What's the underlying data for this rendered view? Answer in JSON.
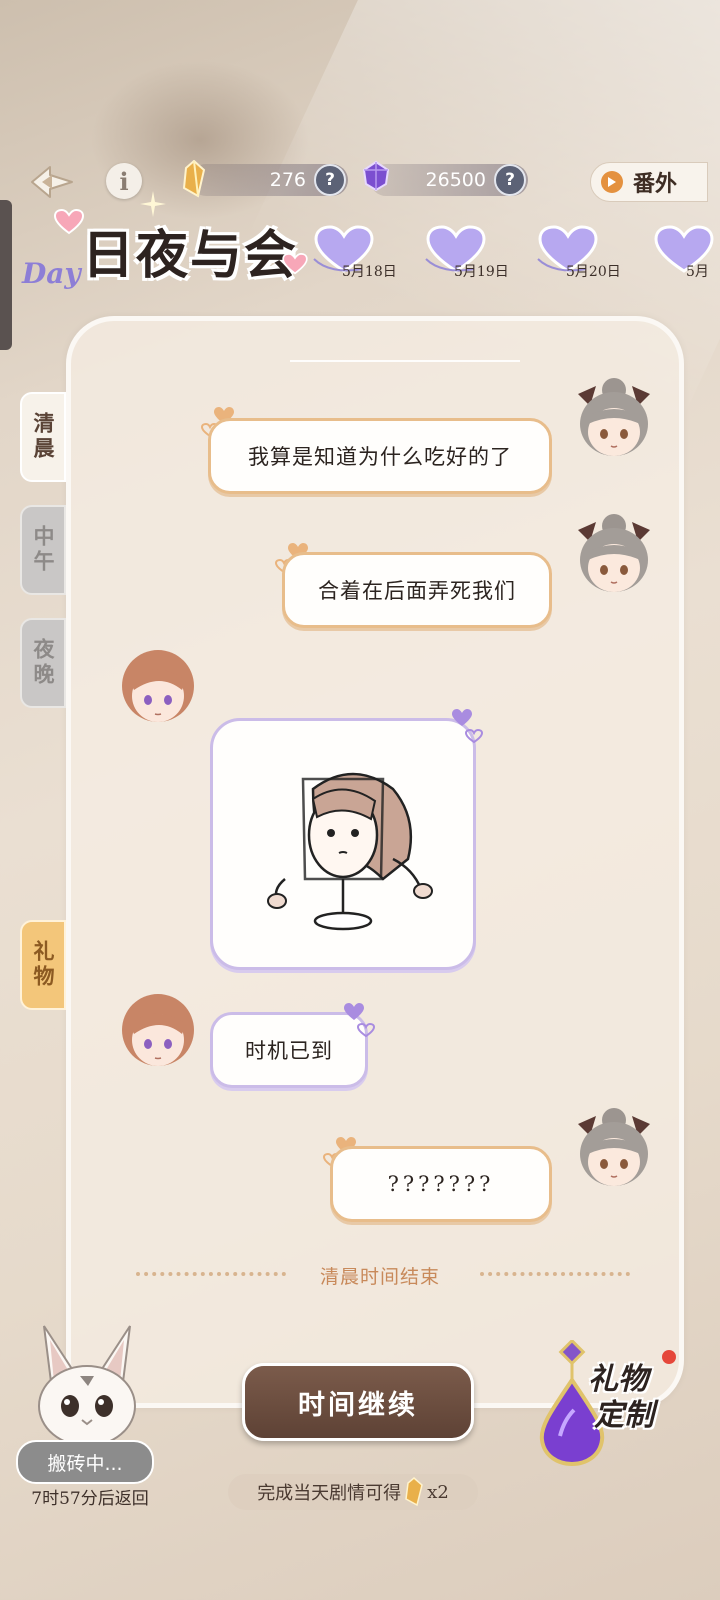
{
  "header": {
    "crystal_amount": "276",
    "gem_amount": "26500",
    "extra_label": "番外"
  },
  "title": {
    "main": "日夜与会",
    "day_tag": "Day"
  },
  "dates": [
    "5月18日",
    "5月19日",
    "5月20日",
    "5月"
  ],
  "tabs": {
    "morning": "清晨",
    "noon": "中午",
    "night": "夜晚",
    "gift": "礼物"
  },
  "chat": {
    "msg1": "我算是知道为什么吃好的了",
    "msg2": "合着在后面弄死我们",
    "msg3": "时机已到",
    "msg4": "???????"
  },
  "end_text": "清晨时间结束",
  "continue_label": "时间继续",
  "reward_note": "完成当天剧情可得",
  "reward_multiplier": "x2",
  "pet": {
    "status": "搬砖中...",
    "return_text": "7时57分后返回"
  },
  "gift_custom": {
    "line1": "礼物",
    "line2": "定制"
  },
  "colors": {
    "me_border": "#e8bd8b",
    "them_border": "#cbbce8",
    "continue_bg": "#6b4c3e",
    "accent_purple": "#8d7ed6"
  }
}
